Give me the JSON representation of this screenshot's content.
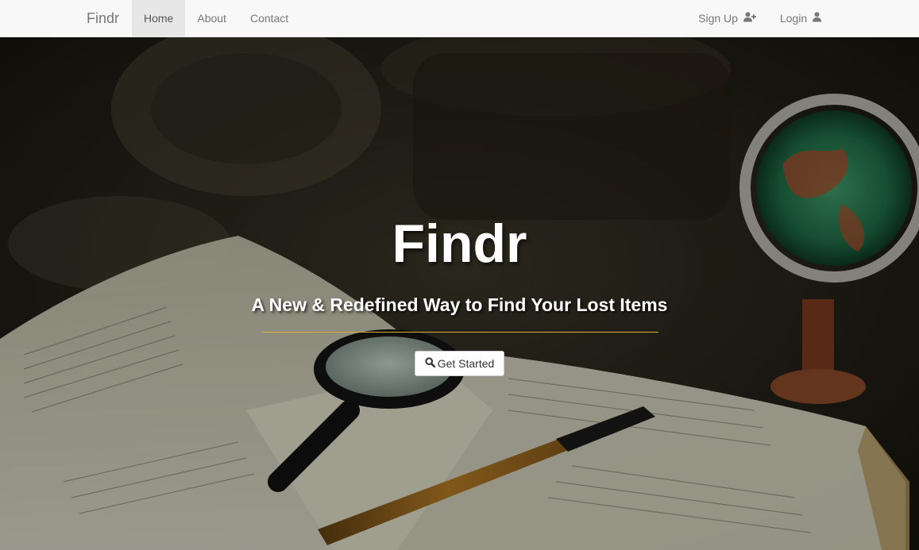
{
  "navbar": {
    "brand": "Findr",
    "left_items": [
      {
        "label": "Home",
        "active": true
      },
      {
        "label": "About",
        "active": false
      },
      {
        "label": "Contact",
        "active": false
      }
    ],
    "right_items": [
      {
        "label": "Sign Up",
        "icon": "user-plus-icon"
      },
      {
        "label": "Login",
        "icon": "user-icon"
      }
    ]
  },
  "hero": {
    "title": "Findr",
    "subtitle": "A New & Redefined Way to Find Your Lost Items",
    "cta_label": "Get Started",
    "cta_icon": "search-icon",
    "divider_color": "#d9b23a"
  },
  "colors": {
    "navbar_bg": "#f8f8f8",
    "nav_text": "#777777",
    "nav_active_bg": "#e7e7e7"
  }
}
